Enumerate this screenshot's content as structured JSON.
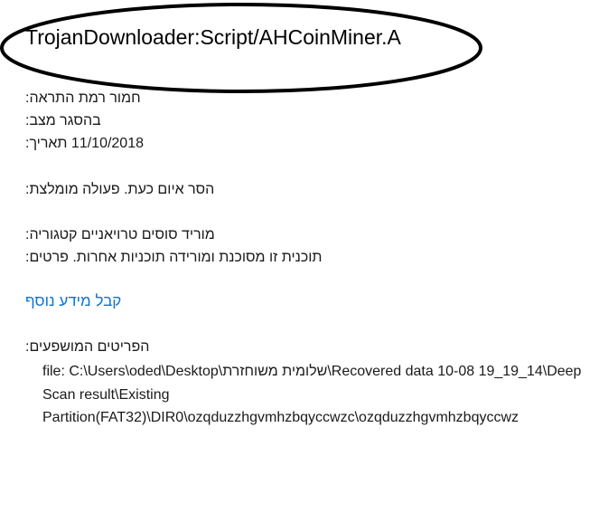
{
  "title": "TrojanDownloader:Script/AHCoinMiner.A",
  "details": {
    "alert_level": "חמור רמת התראה:",
    "status": "בהסגר מצב:",
    "date": "11/10/2018 תאריך:",
    "recommended_action": "הסר איום כעת. פעולה מומלצת:",
    "category": "מוריד סוסים טרויאניים קטגוריה:",
    "description": "תוכנית זו מסוכנת ומורידה תוכניות אחרות. פרטים:"
  },
  "more_info_link": "קבל מידע נוסף",
  "affected_items_label": "הפריטים המושפעים:",
  "affected_item_path": "file: C:\\Users\\oded\\Desktop\\שלומית משוחזרת\\Recovered data 10-08 19_19_14\\Deep Scan result\\Existing Partition(FAT32)\\DIR0\\ozqduzzhgvmhzbqyccwzc\\ozqduzzhgvmhzbqyccwz",
  "colors": {
    "link": "#0a74d4",
    "annotation": "#000000"
  }
}
